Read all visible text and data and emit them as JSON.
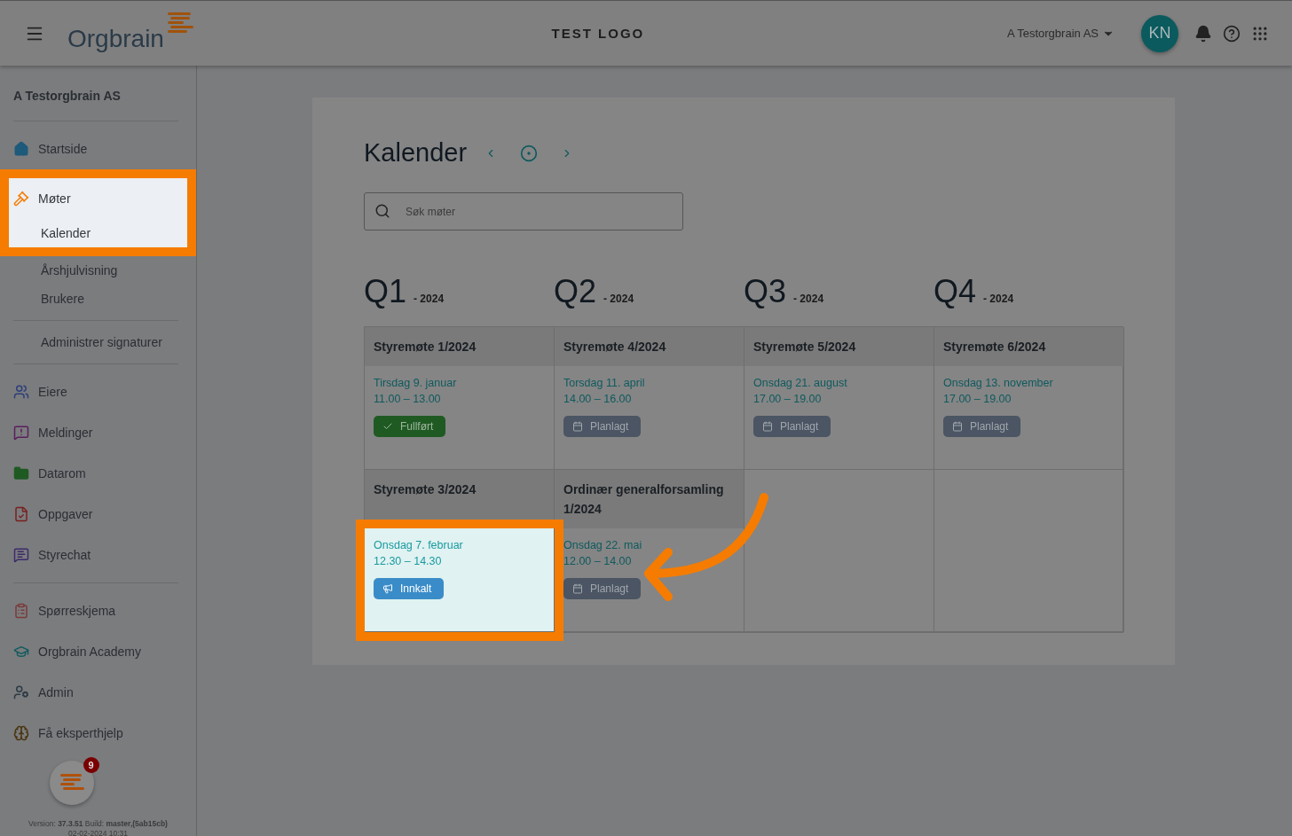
{
  "header": {
    "logo": "Orgbrain",
    "title": "TEST LOGO",
    "org": "A Testorgbrain AS",
    "avatar": "KN"
  },
  "sidebar": {
    "org_name": "A Testorgbrain AS",
    "groups": [
      {
        "items": [
          {
            "label": "Startside",
            "kind": "main",
            "highlighted": false
          },
          {
            "label": "Møter",
            "kind": "main",
            "highlighted": true
          },
          {
            "label": "Kalender",
            "kind": "sub",
            "highlighted": true
          },
          {
            "label": "Årshjulvisning",
            "kind": "sub",
            "highlighted": false
          },
          {
            "label": "Brukere",
            "kind": "sub",
            "highlighted": false
          }
        ]
      },
      {
        "items": [
          {
            "label": "Administrer signaturer",
            "kind": "sub",
            "highlighted": false
          }
        ]
      },
      {
        "items": [
          {
            "label": "Eiere",
            "kind": "main",
            "highlighted": false
          },
          {
            "label": "Meldinger",
            "kind": "main",
            "highlighted": false
          },
          {
            "label": "Datarom",
            "kind": "main",
            "highlighted": false
          },
          {
            "label": "Oppgaver",
            "kind": "main",
            "highlighted": false
          },
          {
            "label": "Styrechat",
            "kind": "main",
            "highlighted": false
          }
        ]
      },
      {
        "items": [
          {
            "label": "Spørreskjema",
            "kind": "main",
            "highlighted": false
          },
          {
            "label": "Orgbrain Academy",
            "kind": "main",
            "highlighted": false
          },
          {
            "label": "Admin",
            "kind": "main",
            "highlighted": false
          },
          {
            "label": "Få eksperthjelp",
            "kind": "main",
            "highlighted": false
          }
        ]
      }
    ],
    "badge": "9",
    "version": "Version: **37.3.51** Build: **master,(5ab15cb)**",
    "build_date": "02-02-2024 10:31"
  },
  "calendar": {
    "title": "Kalender",
    "search": {
      "placeholder": "Søk møter"
    },
    "quarters": [
      {
        "label": "Q1",
        "year": "- 2024",
        "meetings": [
          {
            "title": "Styremøte 1/2024",
            "date": "Tirsdag 9. januar",
            "time": "11.00 – 13.00",
            "status": {
              "kind": "done",
              "label": "Fullført"
            },
            "highlighted": false
          },
          {
            "title": "Styremøte 3/2024",
            "date": "Onsdag 7. februar",
            "time": "12.30 – 14.30",
            "status": {
              "kind": "invited",
              "label": "Innkalt"
            },
            "highlighted": true
          }
        ]
      },
      {
        "label": "Q2",
        "year": "- 2024",
        "meetings": [
          {
            "title": "Styremøte 4/2024",
            "date": "Torsdag 11. april",
            "time": "14.00 – 16.00",
            "status": {
              "kind": "planned",
              "label": "Planlagt"
            },
            "highlighted": false
          },
          {
            "title": "Ordinær generalforsamling 1/2024",
            "date": "Onsdag 22. mai",
            "time": "12.00 – 14.00",
            "status": {
              "kind": "planned",
              "label": "Planlagt"
            },
            "highlighted": false
          }
        ]
      },
      {
        "label": "Q3",
        "year": "- 2024",
        "meetings": [
          {
            "title": "Styremøte 5/2024",
            "date": "Onsdag 21. august",
            "time": "17.00 – 19.00",
            "status": {
              "kind": "planned",
              "label": "Planlagt"
            },
            "highlighted": false
          }
        ]
      },
      {
        "label": "Q4",
        "year": "- 2024",
        "meetings": [
          {
            "title": "Styremøte 6/2024",
            "date": "Onsdag 13. november",
            "time": "17.00 – 19.00",
            "status": {
              "kind": "planned",
              "label": "Planlagt"
            },
            "highlighted": false
          }
        ]
      }
    ]
  }
}
